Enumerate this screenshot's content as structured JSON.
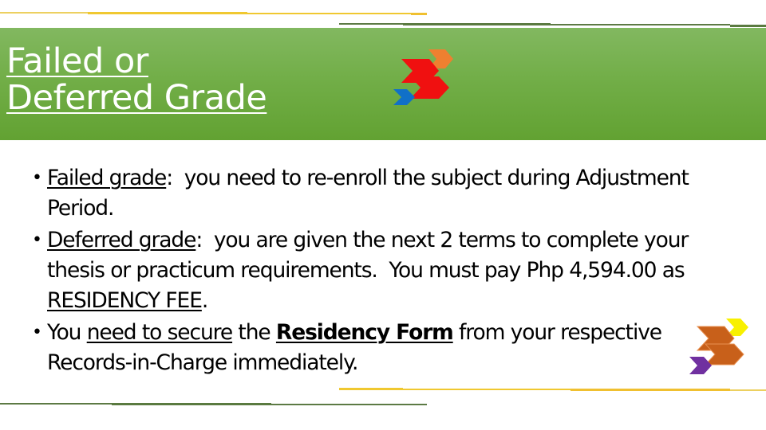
{
  "slide": {
    "title_line1": "Failed or",
    "title_line2": "Deferred Grade",
    "bullets": [
      {
        "term": "Failed grade",
        "colon": ":",
        "text": "  you need to re-enroll the subject during Adjustment Period."
      },
      {
        "term": "Deferred grade",
        "colon": ":",
        "text_before_fee": "  you are given the next 2 terms to complete your thesis or practicum requirements.  You must pay Php 4,594.00 as ",
        "fee_label": "RESIDENCY FEE",
        "text_after_fee": "."
      },
      {
        "prefix": "You ",
        "emph_phrase": "need to secure",
        "middle": " the ",
        "form_name": "Residency Form",
        "suffix": " from your respective Records-in-Charge immediately."
      }
    ],
    "decorations": {
      "top_logo": "arrow-chevrons-icon",
      "bottom_logo": "arrow-chevrons-icon"
    },
    "colors": {
      "banner_green": "#72ae48",
      "accent_yellow": "#f0c830",
      "accent_dark_green": "#5a7a40",
      "logo_top_red": "#f01010",
      "logo_top_orange": "#ee8030",
      "logo_top_blue": "#1070c8",
      "logo_bottom_brown": "#c8601a",
      "logo_bottom_yellow": "#f8f000",
      "logo_bottom_purple": "#7030a0"
    }
  }
}
